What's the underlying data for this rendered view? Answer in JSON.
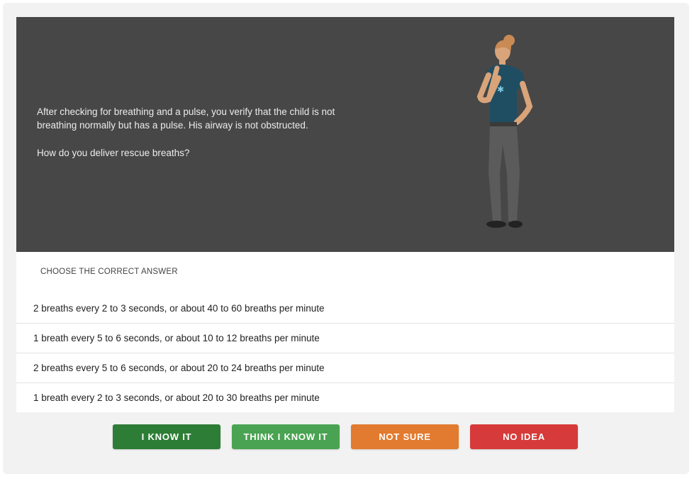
{
  "scenario": {
    "text": "After checking for breathing and a pulse, you verify that the child is not breathing normally but has a pulse. His airway is not obstructed.",
    "question": "How do you deliver rescue breaths?"
  },
  "answers": {
    "prompt": "CHOOSE THE CORRECT ANSWER",
    "options": [
      "2 breaths every 2 to 3 seconds, or about 40 to 60 breaths per minute",
      "1 breath every 5 to 6 seconds, or about 10 to 12 breaths per minute",
      "2 breaths every 5 to 6 seconds, or about 20 to 24 breaths per minute",
      "1 breath every 2 to 3 seconds, or about 20 to 30 breaths per minute"
    ]
  },
  "confidence": {
    "know_it": {
      "label": "I KNOW IT",
      "color": "#2e7d36"
    },
    "think_know_it": {
      "label": "THINK I KNOW IT",
      "color": "#4aa352"
    },
    "not_sure": {
      "label": "NOT SURE",
      "color": "#e27a2f"
    },
    "no_idea": {
      "label": "NO IDEA",
      "color": "#d63a3a"
    }
  },
  "colors": {
    "hero_bg": "#474747",
    "panel_bg": "#f2f2f2"
  }
}
